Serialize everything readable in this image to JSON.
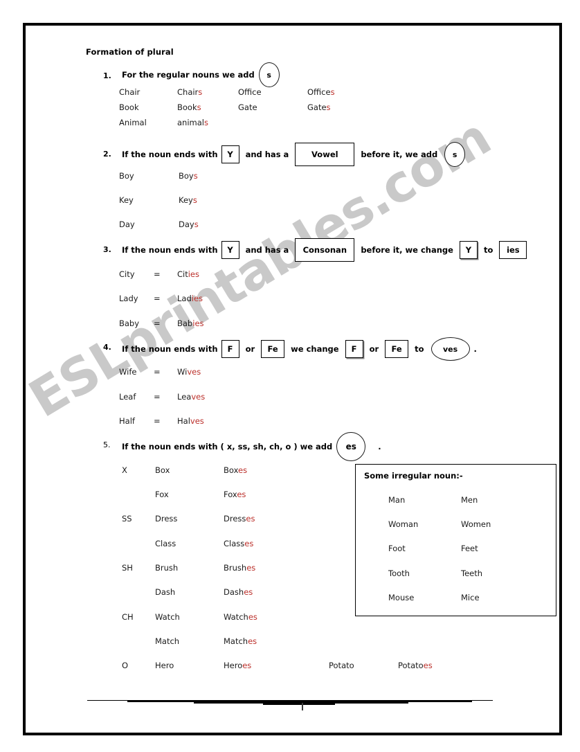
{
  "document": {
    "title": "Formation of plural"
  },
  "watermark": {
    "text": "ESLprintables.com"
  },
  "colors": {
    "suffix_red": "#bb2f2a",
    "ink": "#1a1a1a",
    "watermark_gray": "#c9c9c9",
    "frame_black": "#000000"
  },
  "rules": [
    {
      "number": "1.",
      "lead": "For the regular nouns we add",
      "token": "s",
      "token_shape": "oval",
      "examples": [
        {
          "singular": "Chair",
          "plural_stem": "Chair",
          "plural_suffix": "s",
          "singular2": "Office",
          "plural2_stem": "Office",
          "plural2_suffix": "s"
        },
        {
          "singular": "Book",
          "plural_stem": "Book",
          "plural_suffix": "s",
          "singular2": "Gate",
          "plural2_stem": "Gate",
          "plural2_suffix": "s"
        },
        {
          "singular": "Animal",
          "plural_stem": "animal",
          "plural_suffix": "s",
          "singular2": "",
          "plural2_stem": "",
          "plural2_suffix": ""
        }
      ]
    },
    {
      "number": "2.",
      "seg1": "If the noun ends with",
      "box1": "Y",
      "seg2": "and has a",
      "box2": "Vowel",
      "seg3": "before it, we add",
      "token": "s",
      "examples": [
        {
          "singular": "Boy",
          "plural_stem": "Boy",
          "plural_suffix": "s"
        },
        {
          "singular": "Key",
          "plural_stem": "Key",
          "plural_suffix": "s"
        },
        {
          "singular": "Day",
          "plural_stem": "Day",
          "plural_suffix": "s"
        }
      ]
    },
    {
      "number": "3.",
      "seg1": "If the noun ends with",
      "box1": "Y",
      "seg2": "and has a",
      "box2": "Consonan",
      "seg3": "before it, we change",
      "box3": "Y",
      "seg4": "to",
      "box4": "ies",
      "examples": [
        {
          "singular": "City",
          "eq": "=",
          "plural_stem": "Cit",
          "plural_suffix": "ies"
        },
        {
          "singular": "Lady",
          "eq": "=",
          "plural_stem": "Lad",
          "plural_suffix": "ies"
        },
        {
          "singular": "Baby",
          "eq": "=",
          "plural_stem": "Bab",
          "plural_suffix": "ies"
        }
      ]
    },
    {
      "number": "4.",
      "seg1": "If the noun ends with",
      "box1": "F",
      "seg2": "or",
      "box2": "Fe",
      "seg3": "we change",
      "box3": "F",
      "seg4": "or",
      "box4": "Fe",
      "seg5": "to",
      "token": "ves",
      "trailing": ".",
      "examples": [
        {
          "singular": "Wife",
          "eq": "=",
          "plural_stem": "Wi",
          "plural_suffix": "ves"
        },
        {
          "singular": "Leaf",
          "eq": "=",
          "plural_stem": "Lea",
          "plural_suffix": "ves"
        },
        {
          "singular": "Half",
          "eq": "=",
          "plural_stem": "Hal",
          "plural_suffix": "ves"
        }
      ]
    },
    {
      "number": "5.",
      "lead": "If the noun ends with ( x, ss, sh, ch, o ) we add",
      "token": "es",
      "trailing": ".",
      "table": [
        {
          "key": "X",
          "singular": "Box",
          "plural_stem": "Box",
          "plural_suffix": "es",
          "singular2": "",
          "plural2_stem": "",
          "plural2_suffix": ""
        },
        {
          "key": "",
          "singular": "Fox",
          "plural_stem": "Fox",
          "plural_suffix": "es",
          "singular2": "",
          "plural2_stem": "",
          "plural2_suffix": ""
        },
        {
          "key": "SS",
          "singular": "Dress",
          "plural_stem": "Dress",
          "plural_suffix": "es",
          "singular2": "",
          "plural2_stem": "",
          "plural2_suffix": ""
        },
        {
          "key": "",
          "singular": "Class",
          "plural_stem": "Class",
          "plural_suffix": "es",
          "singular2": "",
          "plural2_stem": "",
          "plural2_suffix": ""
        },
        {
          "key": "SH",
          "singular": "Brush",
          "plural_stem": "Brush",
          "plural_suffix": "es",
          "singular2": "",
          "plural2_stem": "",
          "plural2_suffix": ""
        },
        {
          "key": "",
          "singular": "Dash",
          "plural_stem": "Dash",
          "plural_suffix": "es",
          "singular2": "",
          "plural2_stem": "",
          "plural2_suffix": ""
        },
        {
          "key": "CH",
          "singular": "Watch",
          "plural_stem": "Watch",
          "plural_suffix": "es",
          "singular2": "",
          "plural2_stem": "",
          "plural2_suffix": ""
        },
        {
          "key": "",
          "singular": "Match",
          "plural_stem": "Match",
          "plural_suffix": "es",
          "singular2": "",
          "plural2_stem": "",
          "plural2_suffix": ""
        },
        {
          "key": "O",
          "singular": "Hero",
          "plural_stem": "Hero",
          "plural_suffix": "es",
          "singular2": "Potato",
          "plural2_stem": "Potato",
          "plural2_suffix": "es"
        }
      ]
    }
  ],
  "irregular": {
    "title": "Some irregular noun:-",
    "pairs": [
      {
        "singular": "Man",
        "plural": "Men"
      },
      {
        "singular": "Woman",
        "plural": "Women"
      },
      {
        "singular": "Foot",
        "plural": "Feet"
      },
      {
        "singular": "Tooth",
        "plural": "Teeth"
      },
      {
        "singular": "Mouse",
        "plural": "Mice"
      }
    ]
  },
  "footer": {
    "mark": ""
  }
}
